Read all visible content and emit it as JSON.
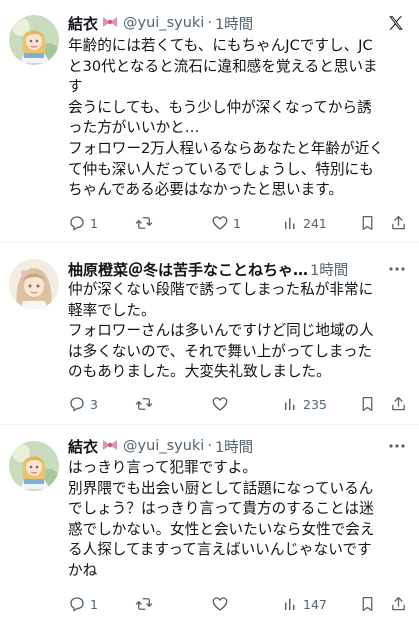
{
  "tweets": [
    {
      "name": "結衣",
      "handle": "@yui_syuki",
      "separator": "·",
      "time": "1時間",
      "lines": [
        "年齢的には若くても、にもちゃんJCですし、JC",
        "と30代となると流石に違和感を覚えると思いま",
        "す",
        "会うにしても、もう少し仲が深くなってから誘",
        "った方がいいかと…",
        "フォロワー2万人程いるならあなたと年齢が近く",
        "て仲も深い人だっているでしょうし、特別にも",
        "ちゃんである必要はなかったと思います。"
      ],
      "replies": "1",
      "retweets": "",
      "likes": "1",
      "views": "241"
    },
    {
      "name": "柚原橙菜＠冬は苦手なことねちゃ…",
      "handle": "",
      "separator": "",
      "time": "1時間",
      "lines": [
        "仲が深くない段階で誘ってしまった私が非常に",
        "軽率でした。",
        "フォロワーさんは多いんですけど同じ地域の人",
        "は多くないので、それで舞い上がってしまった",
        "のもありました。大変失礼致しました。"
      ],
      "replies": "3",
      "retweets": "",
      "likes": "",
      "views": "235"
    },
    {
      "name": "結衣",
      "handle": "@yui_syuki",
      "separator": "·",
      "time": "1時間",
      "lines": [
        "はっきり言って犯罪ですよ。",
        "別界隈でも出会い厨として話題になっているん",
        "でしょう？はっきり言って貴方のすることは迷",
        "惑でしかない。女性と会いたいなら女性で会え",
        "る人探してますって言えばいいんじゃないです",
        "かね"
      ],
      "replies": "1",
      "retweets": "",
      "likes": "",
      "views": "147"
    }
  ],
  "icons": {
    "brand": "x-logo-icon",
    "more": "more-dots-icon",
    "reply": "reply-icon",
    "retweet": "retweet-icon",
    "like": "heart-icon",
    "views": "views-bar-icon",
    "bookmark": "bookmark-icon",
    "share": "share-icon",
    "name_badge": "ribbon-bow-icon"
  },
  "colors": {
    "text": "#0f1419",
    "secondary": "#536471",
    "divider": "#eff3f4",
    "bow": "#e58fb0"
  }
}
